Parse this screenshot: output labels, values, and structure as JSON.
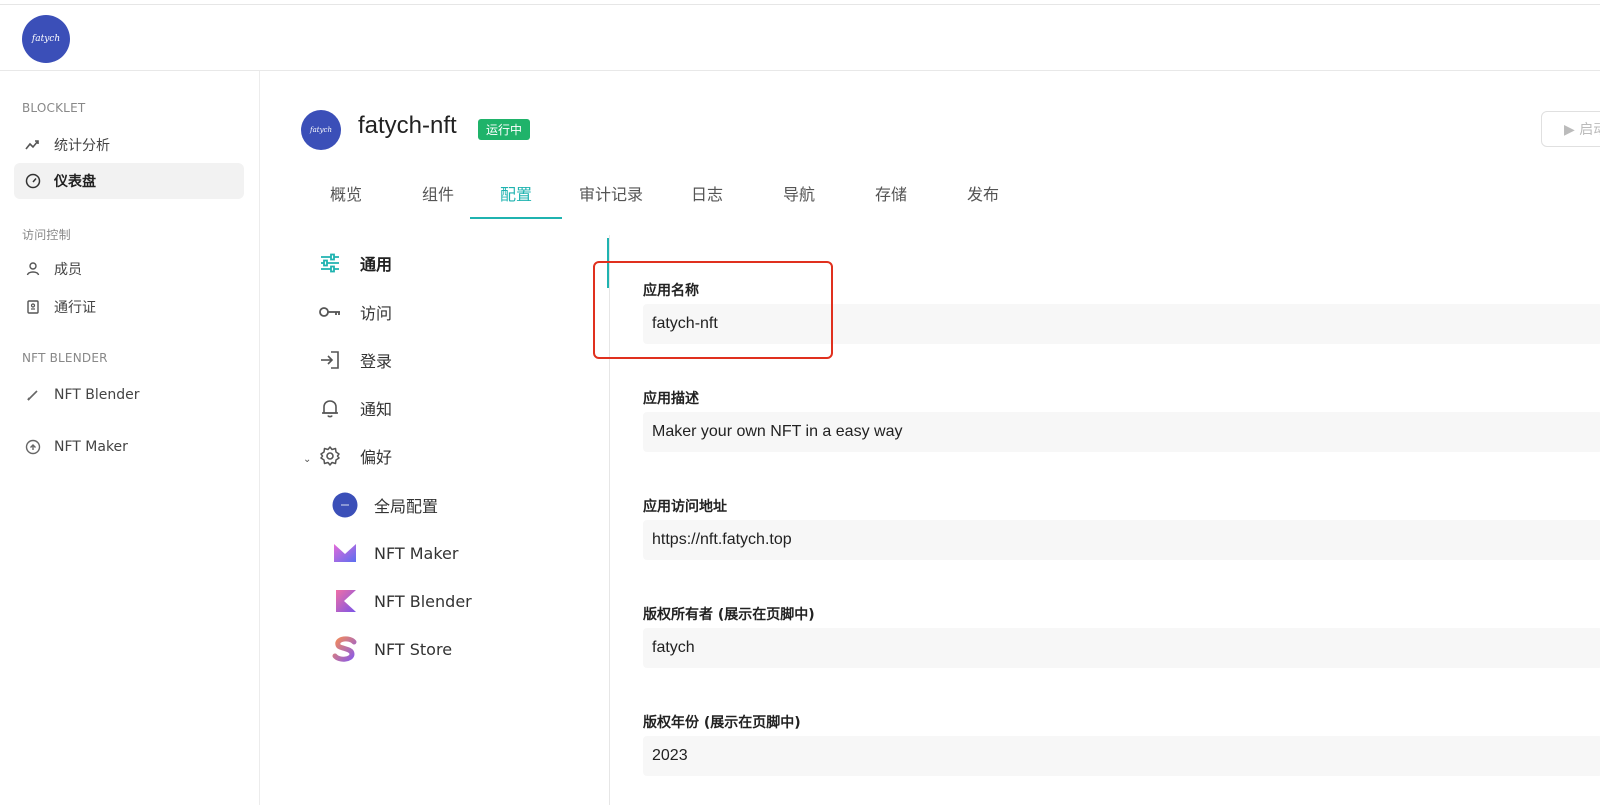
{
  "header": {
    "logo_text": "fatych"
  },
  "sidebar": {
    "sections": [
      {
        "title": "BLOCKLET"
      },
      {
        "title": "访问控制"
      },
      {
        "title": "NFT BLENDER"
      }
    ],
    "items": [
      {
        "label": "统计分析",
        "icon": "analytics-icon"
      },
      {
        "label": "仪表盘",
        "icon": "dashboard-icon"
      },
      {
        "label": "成员",
        "icon": "user-icon"
      },
      {
        "label": "通行证",
        "icon": "passport-icon"
      },
      {
        "label": "NFT Blender",
        "icon": "pencil-icon"
      },
      {
        "label": "NFT Maker",
        "icon": "circle-up-icon"
      }
    ]
  },
  "app": {
    "avatar_text": "fatych",
    "title": "fatych-nft",
    "status": "运行中",
    "start_label": "▶ 启动"
  },
  "tabs": [
    {
      "label": "概览"
    },
    {
      "label": "组件"
    },
    {
      "label": "配置"
    },
    {
      "label": "审计记录"
    },
    {
      "label": "日志"
    },
    {
      "label": "导航"
    },
    {
      "label": "存储"
    },
    {
      "label": "发布"
    }
  ],
  "subnav": {
    "items": [
      {
        "label": "通用",
        "icon": "sliders-icon"
      },
      {
        "label": "访问",
        "icon": "key-icon"
      },
      {
        "label": "登录",
        "icon": "login-icon"
      },
      {
        "label": "通知",
        "icon": "bell-icon"
      },
      {
        "label": "偏好",
        "icon": "gear-icon"
      }
    ],
    "preferences": [
      {
        "label": "全局配置",
        "icon": "fatych-logo-icon"
      },
      {
        "label": "NFT Maker",
        "icon": "nft-maker-icon"
      },
      {
        "label": "NFT Blender",
        "icon": "nft-blender-icon"
      },
      {
        "label": "NFT Store",
        "icon": "nft-store-icon"
      }
    ]
  },
  "form": {
    "fields": [
      {
        "label": "应用名称",
        "value": "fatych-nft"
      },
      {
        "label": "应用描述",
        "value": "Maker your own NFT in a easy way"
      },
      {
        "label": "应用访问地址",
        "value": "https://nft.fatych.top"
      },
      {
        "label": "版权所有者 (展示在页脚中)",
        "value": "fatych"
      },
      {
        "label": "版权年份 (展示在页脚中)",
        "value": "2023"
      }
    ]
  },
  "colors": {
    "accent": "#1fb3b0",
    "status_green": "#1fb36a",
    "highlight_red": "#e0301e",
    "brand_blue": "#3b4fb8"
  }
}
